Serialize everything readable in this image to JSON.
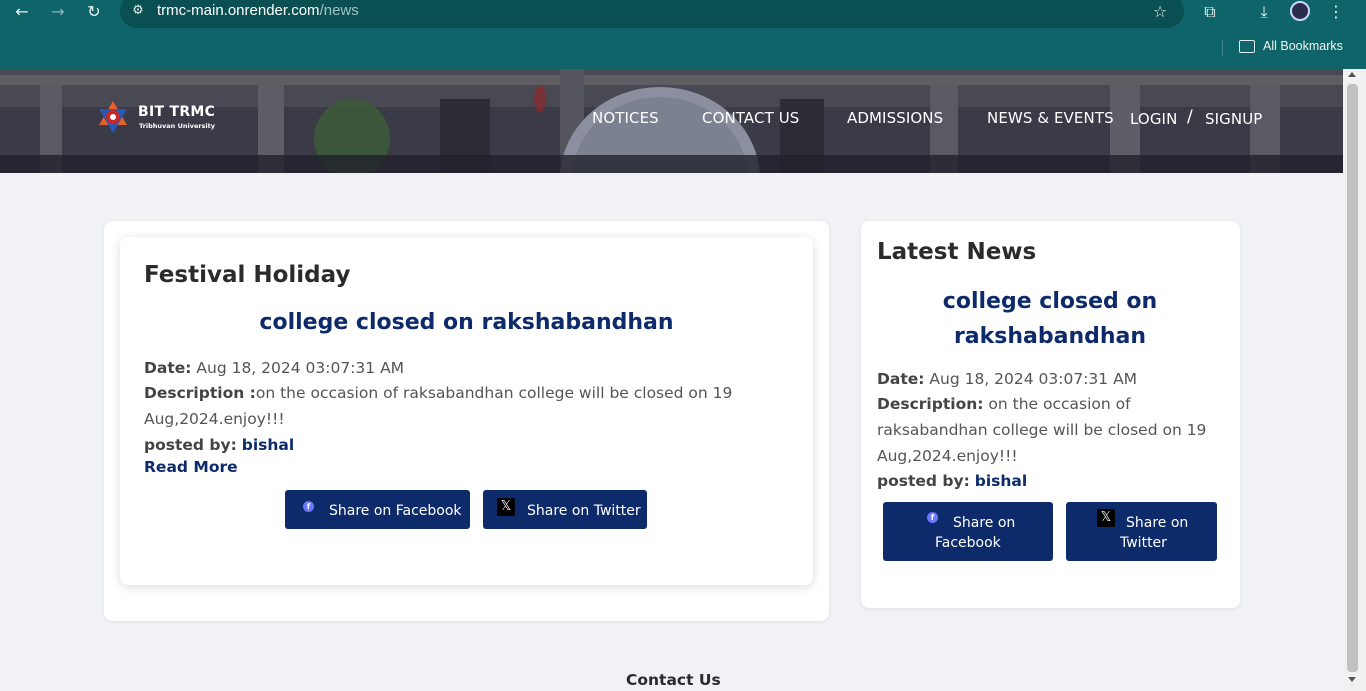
{
  "browser": {
    "url_host": "trmc-main.onrender.com",
    "url_path": "/news",
    "bookmarks_label": "All Bookmarks"
  },
  "site": {
    "logo_title": "BIT TRMC",
    "logo_subtitle": "Tribhuvan University",
    "nav": {
      "notices": "NOTICES",
      "contact": "CONTACT US",
      "admissions": "ADMISSIONS",
      "news_events": "NEWS & EVENTS",
      "login": "LOGIN",
      "slash": "/",
      "signup": "SIGNUP"
    }
  },
  "main_card": {
    "category": "Festival Holiday",
    "title": "college closed on rakshabandhan",
    "date_label": "Date:",
    "date_value": "Aug 18, 2024 03:07:31 AM",
    "desc_label": "Description :",
    "desc_line1": "on the occasion of raksabandhan college will be closed on 19",
    "desc_line2": "Aug,2024.enjoy!!!",
    "posted_label": "posted by:",
    "posted_by": "bishal",
    "read_more": "Read More",
    "share_facebook": "Share on Facebook",
    "share_twitter": "Share on Twitter"
  },
  "latest": {
    "heading": "Latest News",
    "title_line1": "college closed on",
    "title_line2": "rakshabandhan",
    "date_label": "Date:",
    "date_value": "Aug 18, 2024 03:07:31 AM",
    "desc_label": "Description:",
    "desc_line1": "on the occasion of",
    "desc_line2": "raksabandhan college will be closed on 19",
    "desc_line3": "Aug,2024.enjoy!!!",
    "posted_label": "posted by:",
    "posted_by": "bishal",
    "fb_line1": "Share on",
    "fb_line2": "Facebook",
    "tw_line1": "Share on",
    "tw_line2": "Twitter"
  },
  "footer": {
    "contact_title": "Contact Us"
  },
  "icons": {
    "facebook": "facebook-icon",
    "twitter_x": "x-icon"
  },
  "colors": {
    "browser_chrome": "#0e6468",
    "brand_navy": "#0d2a6b",
    "page_bg": "#f0f2f5"
  }
}
